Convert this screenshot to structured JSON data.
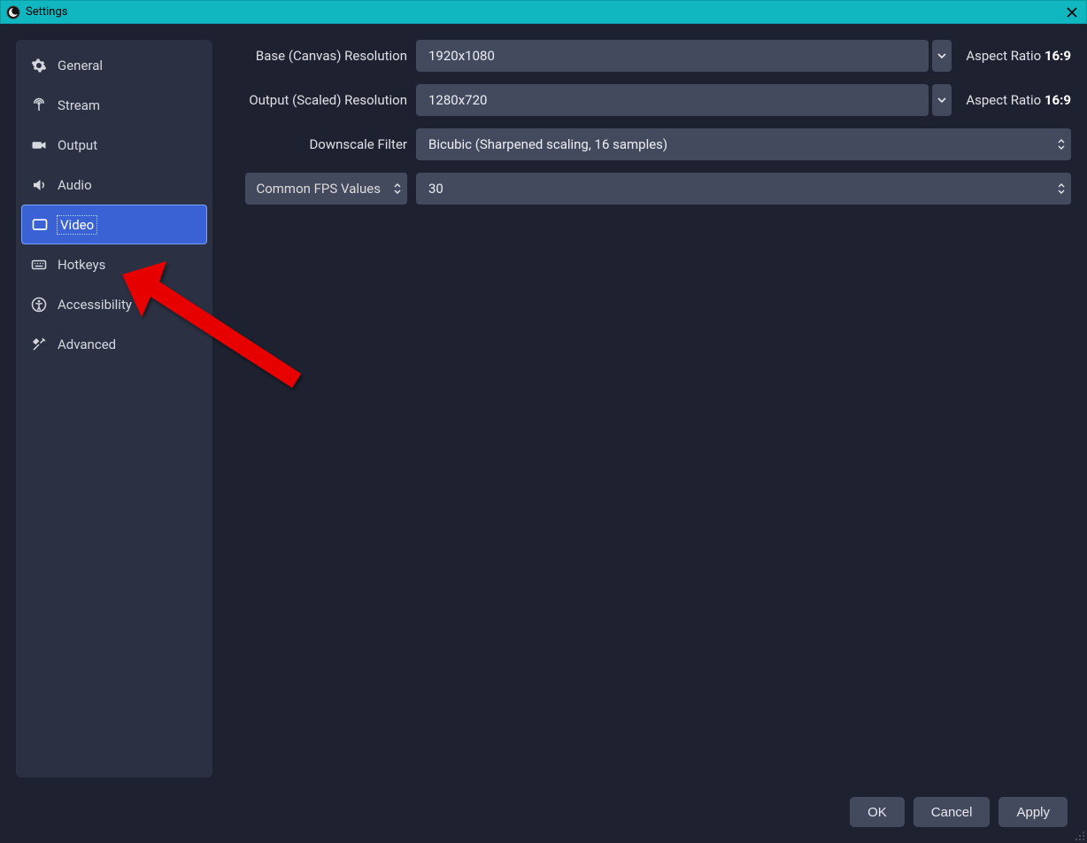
{
  "titlebar": {
    "title": "Settings"
  },
  "sidebar": {
    "items": [
      {
        "id": "general",
        "label": "General",
        "icon": "gear-icon"
      },
      {
        "id": "stream",
        "label": "Stream",
        "icon": "antenna-icon"
      },
      {
        "id": "output",
        "label": "Output",
        "icon": "camera-icon"
      },
      {
        "id": "audio",
        "label": "Audio",
        "icon": "speaker-icon"
      },
      {
        "id": "video",
        "label": "Video",
        "icon": "monitor-icon",
        "active": true
      },
      {
        "id": "hotkeys",
        "label": "Hotkeys",
        "icon": "keyboard-icon"
      },
      {
        "id": "accessibility",
        "label": "Accessibility",
        "icon": "accessibility-icon"
      },
      {
        "id": "advanced",
        "label": "Advanced",
        "icon": "tools-icon"
      }
    ]
  },
  "video": {
    "base_resolution_label": "Base (Canvas) Resolution",
    "base_resolution_value": "1920x1080",
    "base_aspect_prefix": "Aspect Ratio ",
    "base_aspect_value": "16:9",
    "output_resolution_label": "Output (Scaled) Resolution",
    "output_resolution_value": "1280x720",
    "output_aspect_prefix": "Aspect Ratio ",
    "output_aspect_value": "16:9",
    "downscale_filter_label": "Downscale Filter",
    "downscale_filter_value": "Bicubic (Sharpened scaling, 16 samples)",
    "fps_mode_label": "Common FPS Values",
    "fps_value": "30"
  },
  "footer": {
    "ok": "OK",
    "cancel": "Cancel",
    "apply": "Apply"
  }
}
